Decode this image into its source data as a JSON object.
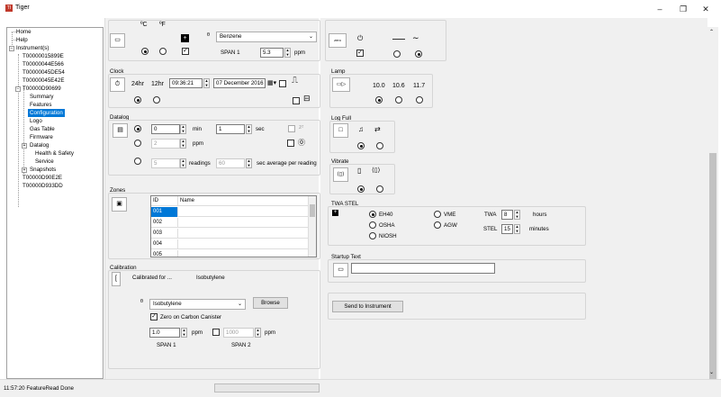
{
  "window": {
    "title": "Tiger",
    "minimize": "–",
    "maximize": "❐",
    "close": "✕",
    "logo_text": "TI"
  },
  "tree": {
    "items": [
      {
        "label": "Home"
      },
      {
        "label": "Help"
      },
      {
        "label": "Instrument(s)"
      },
      {
        "label": "T00000015899E"
      },
      {
        "label": "T00000044E566"
      },
      {
        "label": "T00000045DE54"
      },
      {
        "label": "T00000045E42E"
      },
      {
        "label": "T00000D90699"
      },
      {
        "label": "Summary"
      },
      {
        "label": "Features"
      },
      {
        "label": "Configuration"
      },
      {
        "label": "Logo"
      },
      {
        "label": "Gas Table"
      },
      {
        "label": "Firmware"
      },
      {
        "label": "Datalog"
      },
      {
        "label": "Health & Safety"
      },
      {
        "label": "Service"
      },
      {
        "label": "Snapshots"
      },
      {
        "label": "T00000D90E2E"
      },
      {
        "label": "T00000D933DD"
      }
    ]
  },
  "units": {
    "celsius": "ºC",
    "fahrenheit": "ºF",
    "gas_combo": "Benzene",
    "span1_label": "SPAN 1",
    "span1_value": "5.3",
    "ppm": "ppm"
  },
  "zero": {
    "label": "zero"
  },
  "clock": {
    "title": "Clock",
    "h24": "24hr",
    "h12": "12hr",
    "time": "09:36:21",
    "date": "07 December 2016"
  },
  "lamp": {
    "title": "Lamp",
    "v1": "10.0",
    "v2": "10.6",
    "v3": "11.7"
  },
  "datalog": {
    "title": "Datalog",
    "min_value": "0",
    "min_unit": "min",
    "sec_value": "1",
    "sec_unit": "sec",
    "ppm_value": "2",
    "ppm_unit": "ppm",
    "readings_value": "5",
    "readings_unit": "readings",
    "avg_value": "60",
    "avg_unit": "sec average per reading"
  },
  "logfull": {
    "title": "Log Full"
  },
  "vibrate": {
    "title": "Vibrate"
  },
  "twa": {
    "title": "TWA STEL",
    "eh40": "EH40",
    "osha": "OSHA",
    "niosh": "NIOSH",
    "vme": "VME",
    "agw": "AGW",
    "twa_label": "TWA",
    "twa_value": "8",
    "twa_unit": "hours",
    "stel_label": "STEL",
    "stel_value": "15",
    "stel_unit": "minutes"
  },
  "zones": {
    "title": "Zones",
    "col_id": "ID",
    "col_name": "Name",
    "rows": [
      "001",
      "002",
      "003",
      "004",
      "005"
    ]
  },
  "startup": {
    "title": "Startup Text",
    "value": ""
  },
  "send": {
    "label": "Send to Instrument"
  },
  "calibration": {
    "title": "Calibration",
    "calibrated_for": "Calibrated for ...",
    "gas": "Isobutylene",
    "combo": "Isobutylene",
    "browse": "Browse",
    "zero_carbon": "Zero on Carbon Canister",
    "span1_value": "1.0",
    "span1_unit": "ppm",
    "span2_value": "1000",
    "span2_unit": "ppm",
    "span1_label": "SPAN 1",
    "span2_label": "SPAN 2"
  },
  "status": {
    "text": "11:57:20 FeatureRead Done"
  }
}
